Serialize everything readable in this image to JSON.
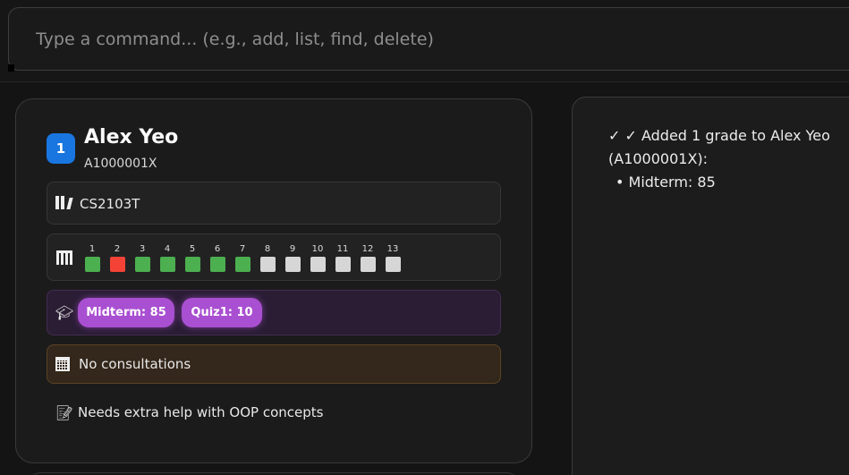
{
  "command": {
    "placeholder": "Type a command... (e.g., add, list, find, delete)"
  },
  "student": {
    "index": "1",
    "name": "Alex Yeo",
    "id": "A1000001X",
    "course": "CS2103T",
    "course_icon": "books-icon",
    "attendance_icon": "attendance-bars-icon",
    "weeks": [
      {
        "label": "1",
        "status": "present"
      },
      {
        "label": "2",
        "status": "absent"
      },
      {
        "label": "3",
        "status": "present"
      },
      {
        "label": "4",
        "status": "present"
      },
      {
        "label": "5",
        "status": "present"
      },
      {
        "label": "6",
        "status": "present"
      },
      {
        "label": "7",
        "status": "present"
      },
      {
        "label": "8",
        "status": "unmarked"
      },
      {
        "label": "9",
        "status": "unmarked"
      },
      {
        "label": "10",
        "status": "unmarked"
      },
      {
        "label": "11",
        "status": "unmarked"
      },
      {
        "label": "12",
        "status": "unmarked"
      },
      {
        "label": "13",
        "status": "unmarked"
      }
    ],
    "grades_icon": "graduation-cap-icon",
    "grades": [
      "Midterm: 85",
      "Quiz1: 10"
    ],
    "consultation_icon": "calendar-icon",
    "consultation": "No consultations",
    "note_icon": "memo-icon",
    "note": "Needs extra help with OOP concepts"
  },
  "result": {
    "message": "✓ ✓ Added 1 grade to Alex Yeo (A1000001X):",
    "bullet": "• Midterm: 85"
  },
  "colors": {
    "present": "#4caf50",
    "absent": "#f44336",
    "unmarked": "#d6d6d6",
    "index_badge": "#1976e0",
    "grade_chip": "#a94fd1"
  }
}
